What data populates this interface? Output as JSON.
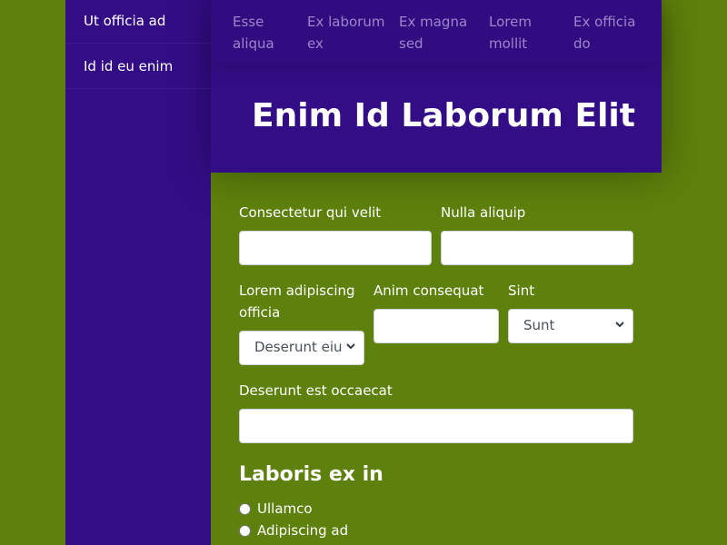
{
  "sidebar": {
    "items": [
      {
        "label": "Ut officia ad"
      },
      {
        "label": "Id id eu enim"
      }
    ]
  },
  "topnav": {
    "links": [
      {
        "line1": "Esse",
        "line2": "aliqua"
      },
      {
        "line1": "Ex laborum",
        "line2": "ex"
      },
      {
        "line1": "Ex magna",
        "line2": "sed"
      },
      {
        "line1": "Lorem",
        "line2": "mollit"
      },
      {
        "line1": "Ex officia",
        "line2": "do"
      }
    ]
  },
  "hero": {
    "title": "Enim Id Laborum Elit"
  },
  "form": {
    "field1": {
      "label": "Consectetur qui velit",
      "value": ""
    },
    "field2": {
      "label": "Nulla aliquip",
      "value": ""
    },
    "select1": {
      "label_line1": "Lorem adipiscing",
      "label_line2": "officia",
      "selected": "Deserunt eiu"
    },
    "field3": {
      "label": "Anim consequat",
      "value": ""
    },
    "select2": {
      "label": "Sint",
      "selected": "Sunt"
    },
    "field4": {
      "label": "Deserunt est occaecat",
      "value": ""
    },
    "section_title": "Laboris ex in",
    "radios": [
      {
        "label": "Ullamco"
      },
      {
        "label": "Adipiscing ad"
      }
    ]
  },
  "colors": {
    "background": "#5e800c",
    "panel": "#330d86",
    "nav_link": "#9c86c9"
  }
}
